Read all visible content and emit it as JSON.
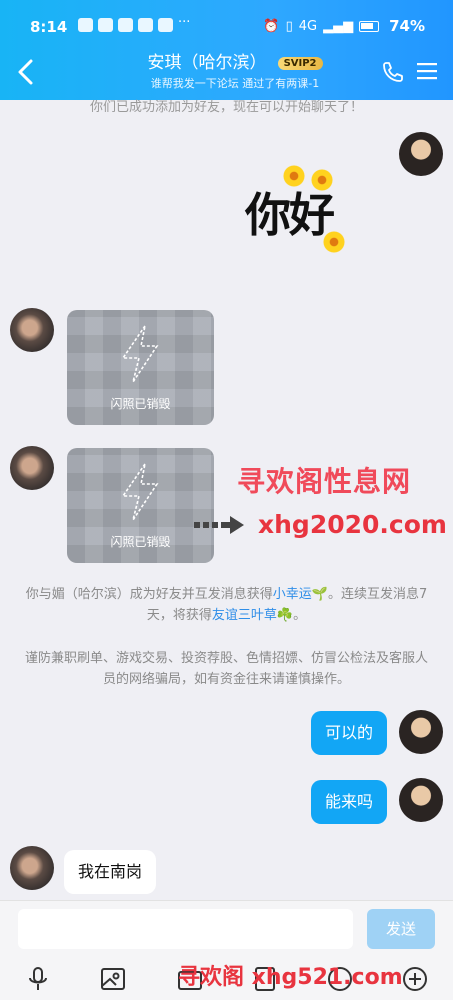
{
  "status": {
    "time": "8:14",
    "battery": "74%",
    "signal": "4G"
  },
  "header": {
    "title": "安琪（哈尔滨）",
    "badge": "SVIP2",
    "subtitle": "谁帮我发一下论坛 通过了有两课-1"
  },
  "system_top": "你们已成功添加为好友，现在可以开始聊天了！",
  "sticker": {
    "text": "你好"
  },
  "flash_photos": [
    {
      "label": "闪照已销毁"
    },
    {
      "label": "闪照已销毁"
    }
  ],
  "watermarks": {
    "site_name": "寻欢阁性息网",
    "site_url": "xhg2020.com",
    "footer": "寻欢阁 xhg521.com"
  },
  "notice1": {
    "before": "你与媚（哈尔滨）成为好友并互发消息获得",
    "link1": "小幸运🌱",
    "middle": "。连续互发消息7天，将获得",
    "link2": "友谊三叶草☘️",
    "after": "。"
  },
  "notice2": "谨防兼职刷单、游戏交易、投资荐股、色情招嫖、仿冒公检法及客服人员的网络骗局，如有资金往来请谨慎操作。",
  "messages": [
    {
      "text": "可以的",
      "side": "out"
    },
    {
      "text": "能来吗",
      "side": "out"
    },
    {
      "text": "我在南岗",
      "side": "in"
    }
  ],
  "composer": {
    "placeholder": "",
    "send_label": "发送"
  },
  "colors": {
    "accent": "#12a6f5",
    "header": "#2ea8ff",
    "watermark": "#e8343f"
  },
  "icons": [
    "back-icon",
    "phone-icon",
    "menu-icon",
    "mic-icon",
    "image-icon",
    "camera-icon",
    "emoji-icon",
    "plus-icon"
  ]
}
